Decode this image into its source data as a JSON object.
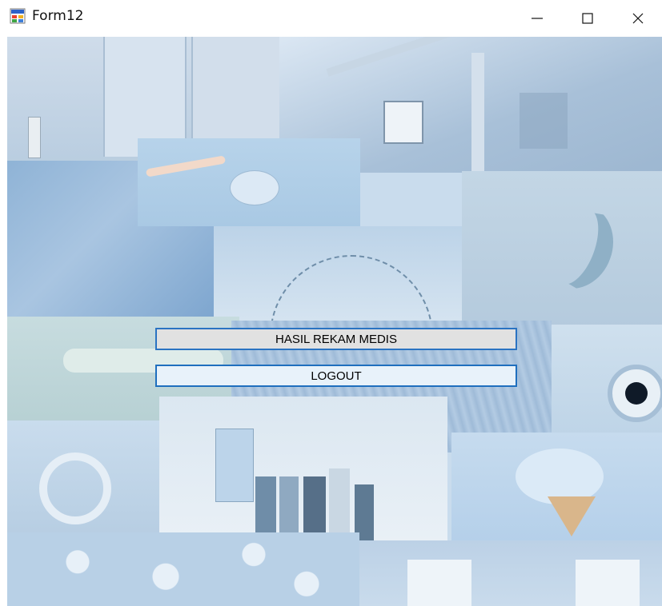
{
  "window": {
    "title": "Form12",
    "controls": {
      "minimize": "minimize-icon",
      "maximize": "maximize-icon",
      "close": "close-icon"
    }
  },
  "buttons": {
    "medical_records": "HASIL REKAM MEDIS",
    "logout": "LOGOUT"
  },
  "background": {
    "theme_color": "#c9dced",
    "accent_color": "#2a73c2"
  }
}
